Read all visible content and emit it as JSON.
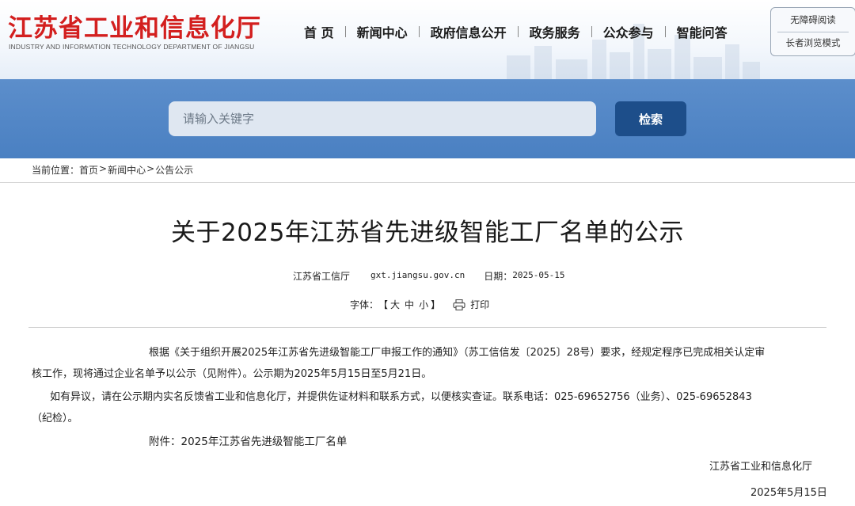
{
  "header": {
    "title_cn": "江苏省工业和信息化厅",
    "title_en": "INDUSTRY AND INFORMATION TECHNOLOGY DEPARTMENT OF JIANGSU",
    "nav": [
      "首 页",
      "新闻中心",
      "政府信息公开",
      "政务服务",
      "公众参与",
      "智能问答"
    ],
    "access_barrier_free": "无障碍阅读",
    "access_elderly": "长者浏览模式"
  },
  "search": {
    "placeholder": "请输入关键字",
    "button": "检索"
  },
  "breadcrumb": {
    "label": "当前位置：",
    "items": [
      "首页",
      "新闻中心",
      "公告公示"
    ],
    "sep": ">"
  },
  "article": {
    "title": "关于2025年江苏省先进级智能工厂名单的公示",
    "source": "江苏省工信厅",
    "site": "gxt.jiangsu.gov.cn",
    "date_label": "日期：",
    "date": "2025-05-15",
    "font_label": "字体：",
    "font_open": "【",
    "font_sizes": [
      "大",
      "中",
      "小"
    ],
    "font_close": "】",
    "print": "打印",
    "para1_line1": "根据《关于组织开展2025年江苏省先进级智能工厂申报工作的通知》（苏工信信发〔2025〕28号）要求，经规定程序已完成相关认定审",
    "para1_line2": "核工作，现将通过企业名单予以公示（见附件）。公示期为2025年5月15日至5月21日。",
    "para2_line1": "如有异议，请在公示期内实名反馈省工业和信息化厅，并提供佐证材料和联系方式，以便核实查证。联系电话：025-69652756（业务）、025-69652843",
    "para2_line2": "（纪检）。",
    "attachment": "附件：2025年江苏省先进级智能工厂名单",
    "signature": "江苏省工业和信息化厅",
    "sign_date": "2025年5月15日"
  },
  "colors": {
    "logo_red": "#d31f1f",
    "search_band": "#4a80c2",
    "search_button": "#1d4e8a"
  }
}
